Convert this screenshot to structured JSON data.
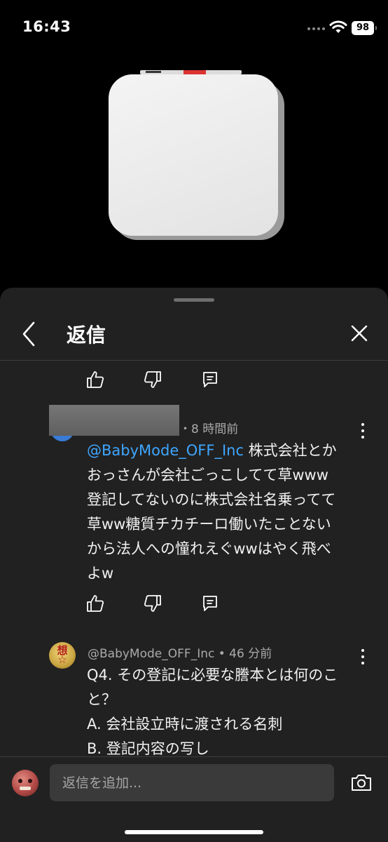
{
  "status_bar": {
    "time": "16:43",
    "battery": "98"
  },
  "header": {
    "title": "返信"
  },
  "comments": [
    {
      "age": "・8 時間前",
      "mention": "@BabyMode_OFF_Inc",
      "lines": [
        " 株式会社とか",
        "おっさんが会社ごっこしてて草www",
        "登記してないのに株式会社名乗ってて",
        "草ww糖質チカチーロ働いたことない",
        "から法人への憧れえぐwwはやく飛べ",
        "よw"
      ]
    },
    {
      "author": "@BabyMode_OFF_Inc",
      "age": " • 46 分前",
      "lines": [
        "Q4. その登記に必要な謄本とは何のこ",
        "と？",
        "A. 会社設立時に渡される名刺",
        "B. 登記内容の写し"
      ]
    }
  ],
  "composer": {
    "placeholder": "返信を追加..."
  },
  "colors": {
    "mention": "#3ea6ff",
    "sheet_bg": "#212121"
  },
  "icons": [
    "thumbs-up-icon",
    "thumbs-down-icon",
    "reply-comment-icon",
    "more-vert-icon",
    "back-chevron-icon",
    "close-icon",
    "camera-icon",
    "wifi-icon"
  ]
}
